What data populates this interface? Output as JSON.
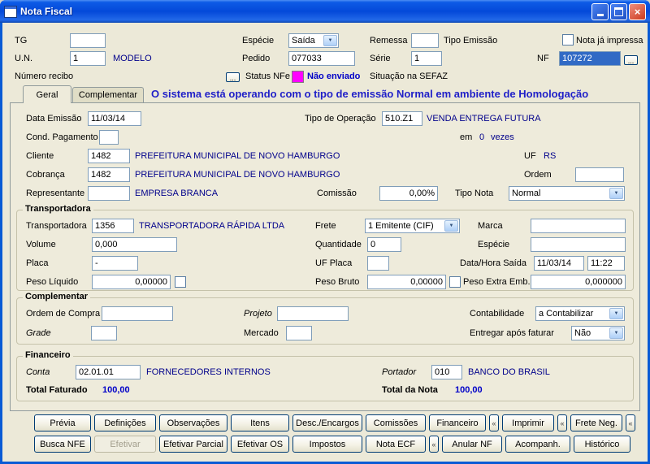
{
  "window": {
    "title": "Nota Fiscal"
  },
  "icons": {
    "dropdown": "▼",
    "close": "×",
    "collapse": "«",
    "ellipsis": "..."
  },
  "colors": {
    "link_blue": "#00008B",
    "message_blue": "#1F1FC8",
    "status_magenta": "#FF00FF",
    "selection_blue": "#316AC5"
  },
  "header": {
    "tg_label": "TG",
    "tg_value": "",
    "especie_label": "Espécie",
    "especie_value": "Saída",
    "remessa_label": "Remessa",
    "remessa_value": "",
    "tipo_emissao_label": "Tipo Emissão",
    "nota_ja_impressa_label": "Nota já impressa",
    "un_label": "U.N.",
    "un_value": "1",
    "un_desc": "MODELO",
    "pedido_label": "Pedido",
    "pedido_value": "077033",
    "serie_label": "Série",
    "serie_value": "1",
    "nf_label": "NF",
    "nf_value": "107272",
    "numero_recibo_label": "Número recibo",
    "status_nfe_label": "Status NFe",
    "status_nfe_value": "Não enviado",
    "status_nfe_swatch_style": "background:#FF00FF",
    "situacao_sefaz_label": "Situação na SEFAZ"
  },
  "tabs": {
    "geral": "Geral",
    "complementar": "Complementar",
    "message": "O sistema está operando com o tipo de emissão Normal em ambiente de Homologação"
  },
  "geral": {
    "data_emissao_label": "Data Emissão",
    "data_emissao_value": "11/03/14",
    "tipo_operacao_label": "Tipo de Operação",
    "tipo_operacao_value": "510.Z1",
    "tipo_operacao_desc": "VENDA ENTREGA FUTURA",
    "cond_pagamento_label": "Cond. Pagamento",
    "cond_pagamento_value": "",
    "em_label": "em",
    "em_value": "0",
    "em_suffix": "vezes",
    "cliente_label": "Cliente",
    "cliente_value": "1482",
    "cliente_desc": "PREFEITURA MUNICIPAL DE NOVO HAMBURGO",
    "uf_label": "UF",
    "uf_value": "RS",
    "cobranca_label": "Cobrança",
    "cobranca_value": "1482",
    "cobranca_desc": "PREFEITURA MUNICIPAL DE NOVO HAMBURGO",
    "ordem_label": "Ordem",
    "ordem_value": "",
    "representante_label": "Representante",
    "representante_value": "",
    "representante_desc": "EMPRESA BRANCA",
    "comissao_label": "Comissão",
    "comissao_value": "0,00%",
    "tipo_nota_label": "Tipo Nota",
    "tipo_nota_value": "Normal"
  },
  "transportadora": {
    "title": "Transportadora",
    "transportadora_label": "Transportadora",
    "transportadora_value": "1356",
    "transportadora_desc": "TRANSPORTADORA RÁPIDA LTDA",
    "frete_label": "Frete",
    "frete_value": "1 Emitente (CIF)",
    "marca_label": "Marca",
    "marca_value": "",
    "volume_label": "Volume",
    "volume_value": "0,000",
    "quantidade_label": "Quantidade",
    "quantidade_value": "0",
    "especie_label": "Espécie",
    "especie_value": "",
    "placa_label": "Placa",
    "placa_value": "-",
    "uf_placa_label": "UF Placa",
    "uf_placa_value": "",
    "data_hora_label": "Data/Hora Saída",
    "data_value": "11/03/14",
    "hora_value": "11:22",
    "peso_liquido_label": "Peso Líquido",
    "peso_liquido_value": "0,00000",
    "peso_bruto_label": "Peso Bruto",
    "peso_bruto_value": "0,00000",
    "peso_extra_label": "Peso Extra Emb.",
    "peso_extra_value": "0,000000"
  },
  "complementar": {
    "title": "Complementar",
    "ordem_compra_label": "Ordem de Compra",
    "ordem_compra_value": "",
    "projeto_label": "Projeto",
    "projeto_value": "",
    "contabilidade_label": "Contabilidade",
    "contabilidade_value": "a Contabilizar",
    "grade_label": "Grade",
    "grade_value": "",
    "mercado_label": "Mercado",
    "mercado_value": "",
    "entregar_label": "Entregar após faturar",
    "entregar_value": "Não"
  },
  "financeiro": {
    "title": "Financeiro",
    "conta_label": "Conta",
    "conta_value": "02.01.01",
    "conta_desc": "FORNECEDORES INTERNOS",
    "portador_label": "Portador",
    "portador_value": "010",
    "portador_desc": "BANCO DO BRASIL",
    "total_faturado_label": "Total Faturado",
    "total_faturado_value": "100,00",
    "total_nota_label": "Total da Nota",
    "total_nota_value": "100,00"
  },
  "buttons": {
    "row1": [
      "Prévia",
      "Definições",
      "Observações",
      "Itens",
      "Desc./Encargos",
      "Comissões",
      "Financeiro",
      "Imprimir",
      "Frete Neg."
    ],
    "row2": [
      "Busca NFE",
      "Efetivar",
      "Efetivar Parcial",
      "Efetivar OS",
      "Impostos",
      "Nota ECF",
      "Anular NF",
      "Acompanh.",
      "Histórico"
    ]
  }
}
